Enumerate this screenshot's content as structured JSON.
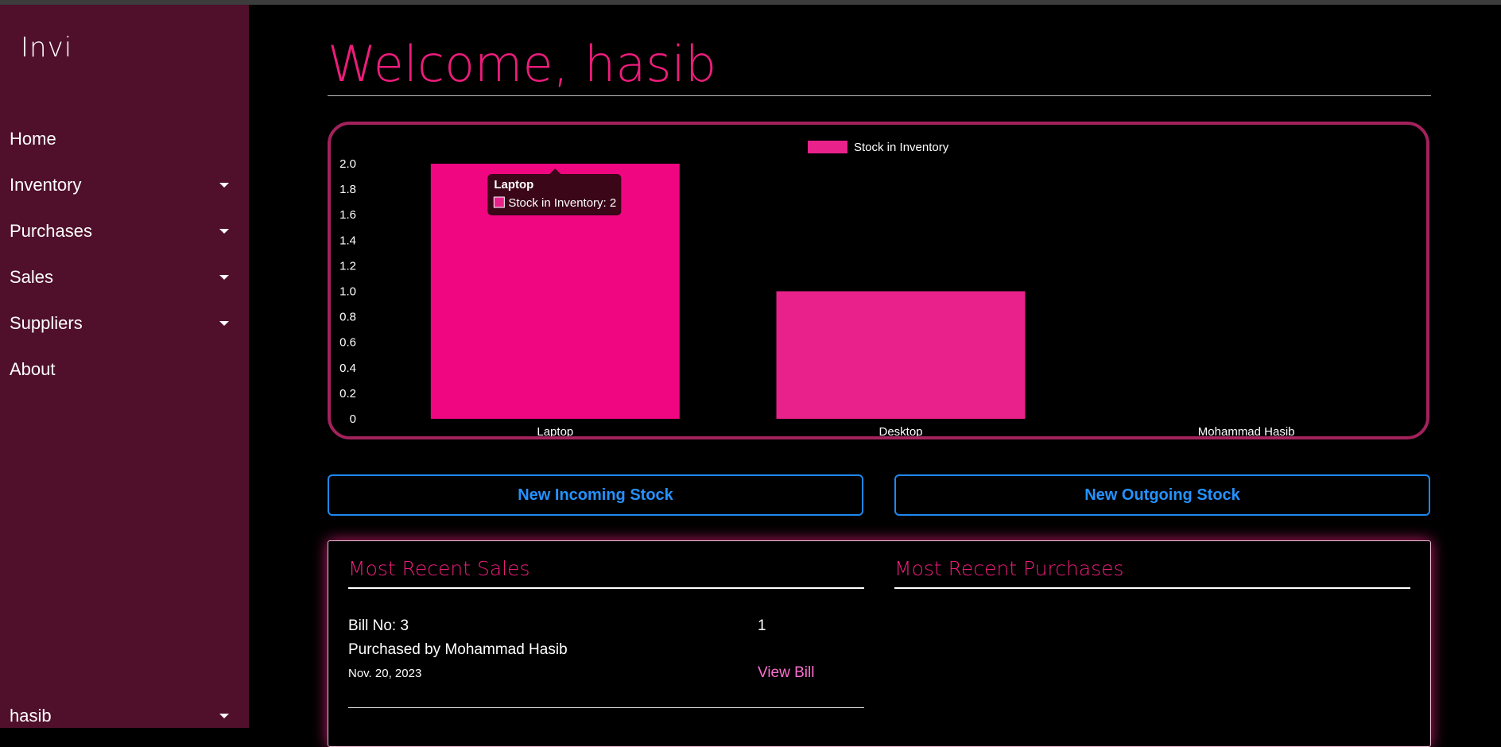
{
  "app": {
    "logo": "Invi"
  },
  "sidebar": {
    "items": [
      {
        "label": "Home",
        "has_dropdown": false
      },
      {
        "label": "Inventory",
        "has_dropdown": true
      },
      {
        "label": "Purchases",
        "has_dropdown": true
      },
      {
        "label": "Sales",
        "has_dropdown": true
      },
      {
        "label": "Suppliers",
        "has_dropdown": true
      },
      {
        "label": "About",
        "has_dropdown": false
      }
    ],
    "user": "hasib"
  },
  "header": {
    "welcome": "Welcome, hasib"
  },
  "chart_data": {
    "type": "bar",
    "categories": [
      "Laptop",
      "Desktop",
      "Mohammad Hasib"
    ],
    "series": [
      {
        "name": "Stock in Inventory",
        "values": [
          2,
          1,
          0
        ]
      }
    ],
    "ylim": [
      0,
      2
    ],
    "yticks": [
      "0",
      "0.2",
      "0.4",
      "0.6",
      "0.8",
      "1.0",
      "1.2",
      "1.4",
      "1.6",
      "1.8",
      "2.0"
    ],
    "legend_position": "top-center",
    "tooltip": {
      "title": "Laptop",
      "text": "Stock in Inventory: 2"
    },
    "colors": {
      "bar_active": "#ef0680",
      "bar": "#e8228a"
    }
  },
  "actions": {
    "incoming": "New Incoming Stock",
    "outgoing": "New Outgoing Stock"
  },
  "recent": {
    "sales_title": "Most Recent Sales",
    "purchases_title": "Most Recent Purchases",
    "sales": [
      {
        "bill": "Bill No: 3",
        "qty": "1",
        "buyer": "Purchased by Mohammad Hasib",
        "date": "Nov. 20, 2023",
        "link": "View Bill"
      }
    ]
  },
  "colors": {
    "sidebar": "#50102b",
    "accent": "#ee1c7c",
    "button": "#2592ff"
  }
}
